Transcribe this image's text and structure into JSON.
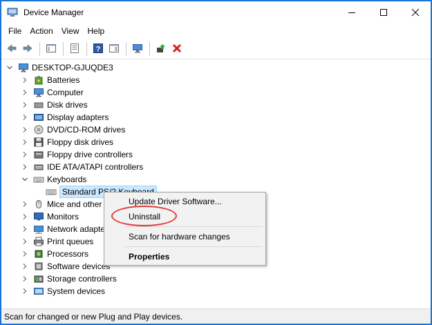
{
  "window": {
    "title": "Device Manager"
  },
  "menu": [
    "File",
    "Action",
    "View",
    "Help"
  ],
  "toolbar": {
    "buttons": [
      "back-icon",
      "forward-icon",
      "show-hide-tree-icon",
      "properties-icon",
      "help-icon",
      "details-icon",
      "scan-hardware-icon",
      "update-driver-icon",
      "uninstall-icon"
    ]
  },
  "tree": {
    "root": "DESKTOP-GJUQDE3",
    "items": [
      {
        "label": "Batteries",
        "icon": "battery-icon"
      },
      {
        "label": "Computer",
        "icon": "computer-icon"
      },
      {
        "label": "Disk drives",
        "icon": "disk-drive-icon"
      },
      {
        "label": "Display adapters",
        "icon": "display-adapter-icon"
      },
      {
        "label": "DVD/CD-ROM drives",
        "icon": "dvd-drive-icon"
      },
      {
        "label": "Floppy disk drives",
        "icon": "floppy-disk-icon"
      },
      {
        "label": "Floppy drive controllers",
        "icon": "floppy-controller-icon"
      },
      {
        "label": "IDE ATA/ATAPI controllers",
        "icon": "ide-controller-icon"
      },
      {
        "label": "Keyboards",
        "icon": "keyboard-icon",
        "expanded": true
      },
      {
        "label": "Standard PS/2 Keyboard",
        "icon": "keyboard-icon",
        "child": true,
        "selected": true
      },
      {
        "label": "Mice and other",
        "icon": "mouse-icon"
      },
      {
        "label": "Monitors",
        "icon": "monitor-icon"
      },
      {
        "label": "Network adapte",
        "icon": "network-adapter-icon"
      },
      {
        "label": "Print queues",
        "icon": "printer-icon"
      },
      {
        "label": "Processors",
        "icon": "processor-icon"
      },
      {
        "label": "Software devices",
        "icon": "software-device-icon"
      },
      {
        "label": "Storage controllers",
        "icon": "storage-controller-icon"
      },
      {
        "label": "System devices",
        "icon": "system-device-icon"
      }
    ]
  },
  "context_menu": {
    "update": "Update Driver Software...",
    "uninstall": "Uninstall",
    "scan": "Scan for hardware changes",
    "properties": "Properties"
  },
  "status": "Scan for changed or new Plug and Play devices.",
  "colors": {
    "frame": "#1a73d9",
    "highlight": "#e23a3a",
    "selected": "#cce8ff"
  }
}
